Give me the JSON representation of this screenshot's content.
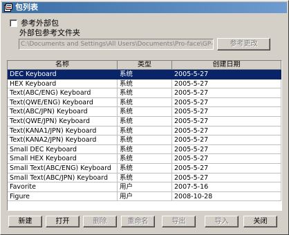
{
  "window": {
    "title": "包列表"
  },
  "options": {
    "reference_external_label": "参考外部包",
    "folder_label": "外部包参考文件夹",
    "folder_path": "C:\\Documents and Settings\\All Users\\Documents\\Pro-face\\GP-Pro EX 2.",
    "change_reference_button": "参考更改"
  },
  "table": {
    "columns": [
      "名称",
      "类型",
      "创建日期"
    ],
    "rows": [
      [
        "DEC Keyboard",
        "系统",
        "2005-5-27"
      ],
      [
        "HEX Keyboard",
        "系统",
        "2005-5-27"
      ],
      [
        "Text(ABC/ENG) Keyboard",
        "系统",
        "2005-5-27"
      ],
      [
        "Text(QWE/ENG) Keyboard",
        "系统",
        "2005-5-27"
      ],
      [
        "Text(ABC/JPN) Keyboard",
        "系统",
        "2005-5-27"
      ],
      [
        "Text(QWE/JPN) Keyboard",
        "系统",
        "2005-5-27"
      ],
      [
        "Text(KANA1/JPN) Keyboard",
        "系统",
        "2005-5-27"
      ],
      [
        "Text(KANA2/JPN) Keyboard",
        "系统",
        "2005-5-27"
      ],
      [
        "Small DEC Keyboard",
        "系统",
        "2005-5-27"
      ],
      [
        "Small HEX Keyboard",
        "系统",
        "2005-5-27"
      ],
      [
        "Small Text(ABC/ENG) Keyboard",
        "系统",
        "2005-5-27"
      ],
      [
        "Small Text(ABC/JPN) Keyboard",
        "系统",
        "2005-5-27"
      ],
      [
        "Favorite",
        "用户",
        "2007-5-16"
      ],
      [
        "Figure",
        "用户",
        "2008-10-28"
      ]
    ],
    "selected_row": 0
  },
  "buttons": {
    "new": "新建",
    "open": "打开",
    "delete": "删除",
    "rename": "重命名",
    "export": "导出",
    "import": "导入",
    "close": "关闭"
  }
}
